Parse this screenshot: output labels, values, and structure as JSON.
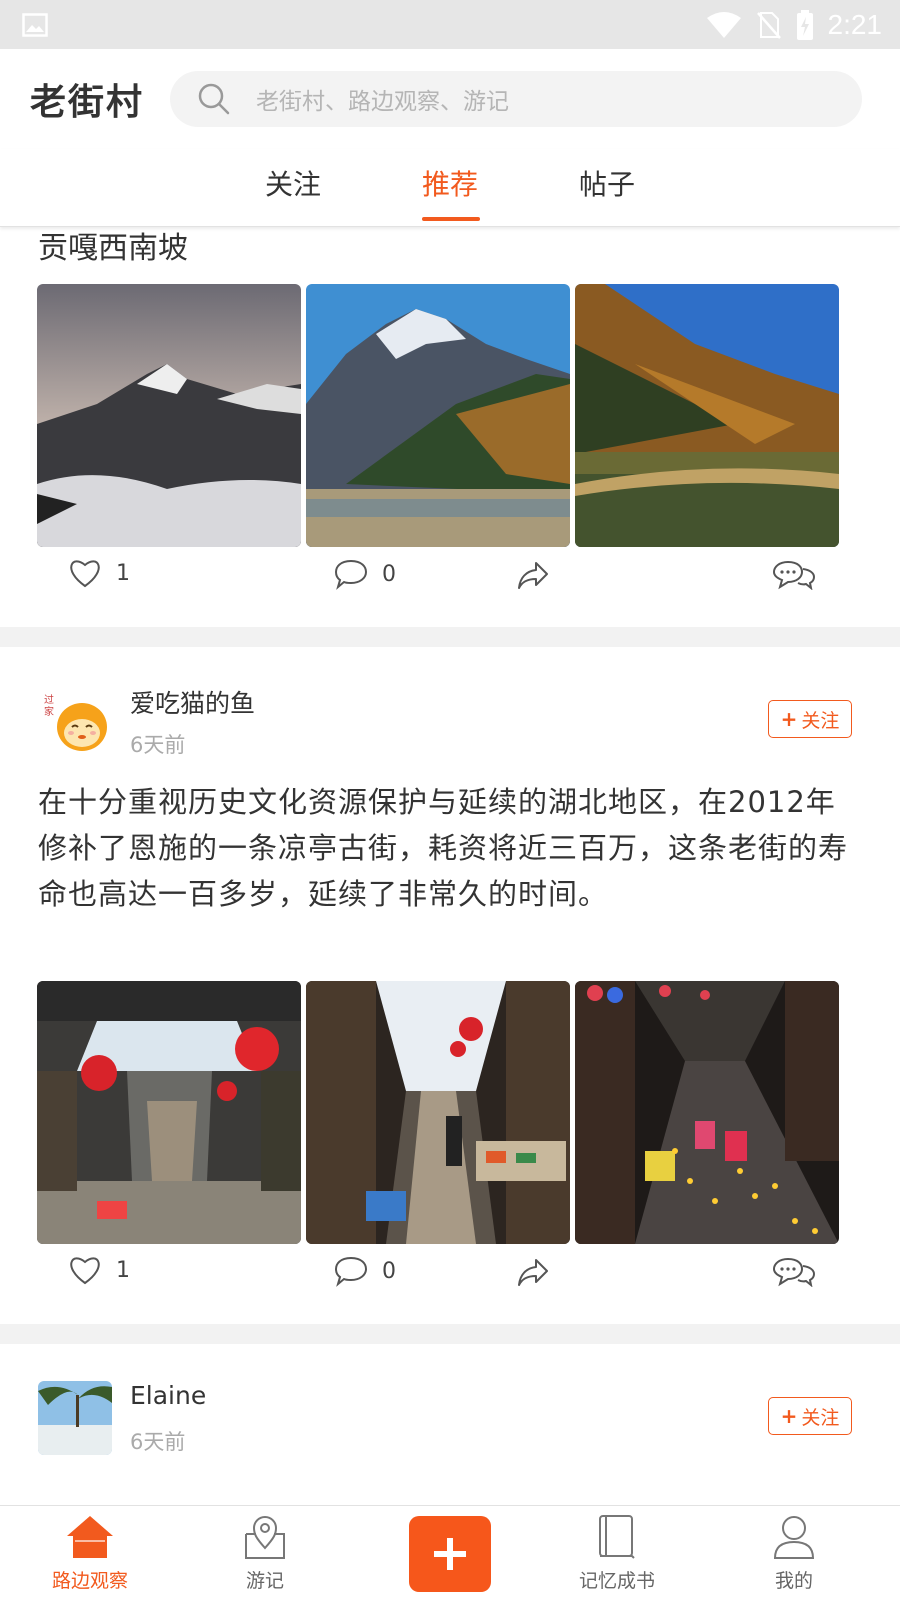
{
  "status_bar": {
    "time": "2:21",
    "icons": [
      "image-icon",
      "wifi-icon",
      "no-sim-icon",
      "battery-charging-icon"
    ]
  },
  "header": {
    "app_title": "老街村",
    "search_placeholder": "老街村、路边观察、游记"
  },
  "tabs": [
    {
      "label": "关注",
      "active": false
    },
    {
      "label": "推荐",
      "active": true
    },
    {
      "label": "帖子",
      "active": false
    }
  ],
  "posts": [
    {
      "title": "贡嘎西南坡",
      "images": [
        "snow-mountain-sunset",
        "snow-mountain-valley",
        "autumn-mountain-lake"
      ],
      "likes": "1",
      "comments": "0"
    },
    {
      "author": "爱吃猫的鱼",
      "time": "6天前",
      "follow_label": "关注",
      "text": "在十分重视历史文化资源保护与延续的湖北地区，在2012年修补了恩施的一条凉亭古街，耗资将近三百万，这条老街的寿命也高达一百多岁，延续了非常久的时间。",
      "images": [
        "old-street-lanterns",
        "old-street-market",
        "old-street-candles"
      ],
      "likes": "1",
      "comments": "0"
    },
    {
      "author": "Elaine",
      "time": "6天前",
      "follow_label": "关注"
    }
  ],
  "bottom_nav": [
    {
      "label": "路边观察",
      "icon": "home-icon",
      "active": true
    },
    {
      "label": "游记",
      "icon": "map-pin-icon",
      "active": false
    },
    {
      "label": "",
      "icon": "add-icon",
      "active": false
    },
    {
      "label": "记忆成书",
      "icon": "book-icon",
      "active": false
    },
    {
      "label": "我的",
      "icon": "user-icon",
      "active": false
    }
  ],
  "colors": {
    "accent": "#f25a1e",
    "divider": "#f2f2f2",
    "status_bar": "#e6e6e6"
  }
}
